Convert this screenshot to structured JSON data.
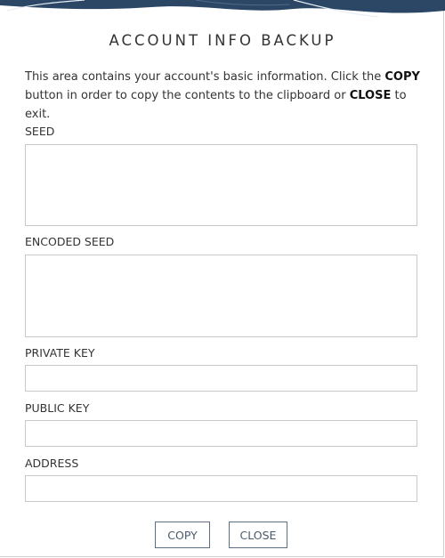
{
  "dialog": {
    "title": "ACCOUNT INFO BACKUP",
    "description": {
      "part1": "This area contains your account's basic information. Click the ",
      "copy_word": "COPY",
      "part2": " button in order to copy the contents to the clipboard or ",
      "close_word": "CLOSE",
      "part3": " to exit."
    }
  },
  "fields": {
    "seed": {
      "label": "SEED",
      "value": ""
    },
    "encoded_seed": {
      "label": "ENCODED SEED",
      "value": ""
    },
    "private_key": {
      "label": "PRIVATE KEY",
      "value": ""
    },
    "public_key": {
      "label": "PUBLIC KEY",
      "value": ""
    },
    "address": {
      "label": "ADDRESS",
      "value": ""
    }
  },
  "buttons": {
    "copy_label": "COPY",
    "close_label": "CLOSE"
  },
  "colors": {
    "header_wave": "#2c4766",
    "button_border": "#5c6f82",
    "field_border": "#c8c8c8"
  }
}
